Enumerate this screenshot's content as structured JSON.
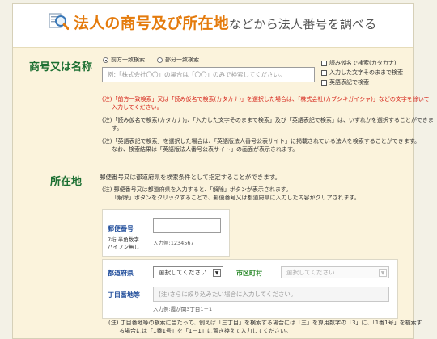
{
  "header": {
    "title_main": "法人の商号及び所在地",
    "title_rest": "などから法人番号を調べる",
    "icon": "magnifier-document-icon"
  },
  "name_section": {
    "label": "商号又は名称",
    "radio_prefix": "前方一致検索",
    "radio_partial": "部分一致検索",
    "placeholder": "例:「株式会社〇〇」の場合は「〇〇」のみで検索してください。",
    "checkbox_kana": "読み仮名で検索(カタカナ)",
    "checkbox_exact": "入力した文字そのままで検索",
    "checkbox_english": "英語表記で検索",
    "note1_a": "(注)「前方一致検索」又は「読み仮名で検索(カタカナ)」を選択した場合は、「株式会社(カブシキガイシャ)」などの文字を除いて",
    "note1_b": "入力してください。",
    "note2_a": "(注)「読み仮名で検索(カタカナ)」、「入力した文字そのままで検索」及び「英語表記で検索」は、いずれかを選択することができま",
    "note2_b": "す。",
    "note3_a": "(注)「英語表記で検索」を選択した場合は、「英語版法人番号公表サイト」に掲載されている法人を検索することができます。",
    "note3_b": "なお、検索結果は「英語版法人番号公表サイト」の画面が表示されます。"
  },
  "location_section": {
    "label": "所在地",
    "intro": "郵便番号又は都道府県を検索条件として指定することができます。",
    "note_a": "(注) 郵便番号又は都道府県を入力すると、「解除」ボタンが表示されます。",
    "note_b": "「解除」ボタンをクリックすることで、郵便番号又は都道府県に入力した内容がクリアされます。",
    "postal_label": "郵便番号",
    "postal_hint_a": "7桁 半角数字",
    "postal_hint_b": "ハイフン無し",
    "postal_example": "入力例:1234567",
    "pref_label": "都道府県",
    "pref_value": "選択してください",
    "city_label": "市区町村",
    "city_value": "選択してください",
    "chome_label": "丁目番地等",
    "chome_placeholder": "(注)さらに絞り込みたい場合に入力してください。",
    "chome_example": "入力例:霞が関3丁目1－1",
    "bottom_note_a": "(注) 丁目番地等の検索に当たって、例えば「三丁目」を検索する場合には「三」を算用数字の「3」に、「1番1号」を検索す",
    "bottom_note_b": "る場合には「1番1号」を「1－1」に置き換えて入力してください。"
  },
  "colors": {
    "title_orange": "#e47b0d",
    "section_label_green": "#1c6f32",
    "note_red": "#d52116",
    "field_label_blue": "#1f4c9a",
    "city_label_green": "#2c8a2c",
    "section_bg": "#fbf3dc"
  }
}
